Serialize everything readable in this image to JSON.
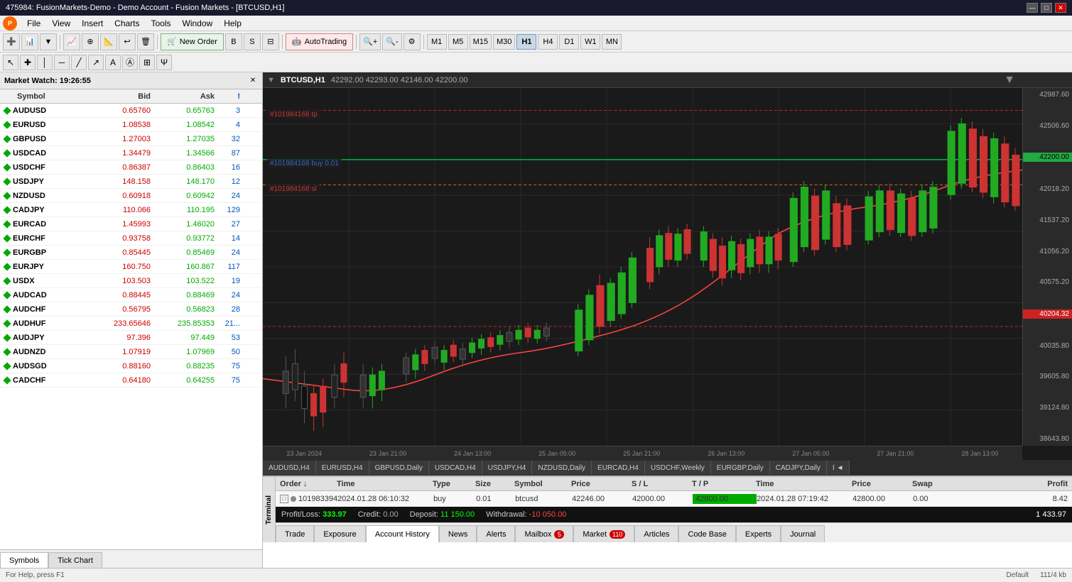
{
  "titlebar": {
    "title": "475984: FusionMarkets-Demo - Demo Account - Fusion Markets - [BTCUSD,H1]",
    "minimize": "—",
    "maximize": "□",
    "close": "✕"
  },
  "menubar": {
    "items": [
      "File",
      "View",
      "Insert",
      "Charts",
      "Tools",
      "Window",
      "Help"
    ]
  },
  "toolbar": {
    "new_order": "New Order",
    "autotrading": "AutoTrading",
    "timeframes": [
      "M1",
      "M5",
      "M15",
      "M30",
      "H1",
      "H4",
      "D1",
      "W1",
      "MN"
    ],
    "active_tf": "H1"
  },
  "market_watch": {
    "title": "Market Watch: 19:26:55",
    "columns": [
      "Symbol",
      "Bid",
      "Ask",
      "!"
    ],
    "rows": [
      {
        "symbol": "AUDUSD",
        "bid": "0.65760",
        "ask": "0.65763",
        "spread": "3",
        "dir": "up"
      },
      {
        "symbol": "EURUSD",
        "bid": "1.08538",
        "ask": "1.08542",
        "spread": "4",
        "dir": "up"
      },
      {
        "symbol": "GBPUSD",
        "bid": "1.27003",
        "ask": "1.27035",
        "spread": "32",
        "dir": "up"
      },
      {
        "symbol": "USDCAD",
        "bid": "1.34479",
        "ask": "1.34566",
        "spread": "87",
        "dir": "up"
      },
      {
        "symbol": "USDCHF",
        "bid": "0.86387",
        "ask": "0.86403",
        "spread": "16",
        "dir": "up"
      },
      {
        "symbol": "USDJPY",
        "bid": "148.158",
        "ask": "148.170",
        "spread": "12",
        "dir": "up"
      },
      {
        "symbol": "NZDUSD",
        "bid": "0.60918",
        "ask": "0.60942",
        "spread": "24",
        "dir": "up"
      },
      {
        "symbol": "CADJPY",
        "bid": "110.066",
        "ask": "110.195",
        "spread": "129",
        "dir": "up"
      },
      {
        "symbol": "EURCAD",
        "bid": "1.45993",
        "ask": "1.46020",
        "spread": "27",
        "dir": "up"
      },
      {
        "symbol": "EURCHF",
        "bid": "0.93758",
        "ask": "0.93772",
        "spread": "14",
        "dir": "up"
      },
      {
        "symbol": "EURGBP",
        "bid": "0.85445",
        "ask": "0.85469",
        "spread": "24",
        "dir": "up"
      },
      {
        "symbol": "EURJPY",
        "bid": "160.750",
        "ask": "160.867",
        "spread": "117",
        "dir": "up"
      },
      {
        "symbol": "USDX",
        "bid": "103.503",
        "ask": "103.522",
        "spread": "19",
        "dir": "up"
      },
      {
        "symbol": "AUDCAD",
        "bid": "0.88445",
        "ask": "0.88469",
        "spread": "24",
        "dir": "up"
      },
      {
        "symbol": "AUDCHF",
        "bid": "0.56795",
        "ask": "0.56823",
        "spread": "28",
        "dir": "up"
      },
      {
        "symbol": "AUDHUF",
        "bid": "233.65646",
        "ask": "235.85353",
        "spread": "21...",
        "dir": "up"
      },
      {
        "symbol": "AUDJPY",
        "bid": "97.396",
        "ask": "97.449",
        "spread": "53",
        "dir": "up"
      },
      {
        "symbol": "AUDNZD",
        "bid": "1.07919",
        "ask": "1.07969",
        "spread": "50",
        "dir": "up"
      },
      {
        "symbol": "AUDSGD",
        "bid": "0.88160",
        "ask": "0.88235",
        "spread": "75",
        "dir": "up"
      },
      {
        "symbol": "CADCHF",
        "bid": "0.64180",
        "ask": "0.64255",
        "spread": "75",
        "dir": "up"
      }
    ]
  },
  "left_tabs": {
    "tabs": [
      "Symbols",
      "Tick Chart"
    ],
    "active": "Symbols"
  },
  "chart": {
    "header": {
      "symbol": "BTCUSD,H1",
      "prices": "42292.00  42293.00  42146.00  42200.00"
    },
    "price_levels": [
      {
        "price": "42987.60",
        "y_pct": 2
      },
      {
        "price": "42506.60",
        "y_pct": 12
      },
      {
        "price": "42200.00",
        "y_pct": 20,
        "highlight": "green"
      },
      {
        "price": "42018.20",
        "y_pct": 25
      },
      {
        "price": "41537.20",
        "y_pct": 36
      },
      {
        "price": "41056.20",
        "y_pct": 47
      },
      {
        "price": "40575.20",
        "y_pct": 58
      },
      {
        "price": "40204.32",
        "y_pct": 65,
        "highlight": "red"
      },
      {
        "price": "40035.80",
        "y_pct": 67
      },
      {
        "price": "39605.80",
        "y_pct": 77
      },
      {
        "price": "39124.80",
        "y_pct": 87
      },
      {
        "price": "38643.80",
        "y_pct": 97
      }
    ],
    "order_lines": [
      {
        "label": "#101984168 tp",
        "y_pct": 8,
        "color": "#cc2222",
        "style": "dashed"
      },
      {
        "label": "#101984168 buy 0.01",
        "y_pct": 20,
        "color": "#2266cc",
        "style": "solid"
      },
      {
        "label": "#101984168 sl",
        "y_pct": 27,
        "color": "#cc2222",
        "style": "dashed"
      }
    ],
    "time_labels": [
      "23 Jan 2024",
      "23 Jan 21:00",
      "24 Jan 13:00",
      "25 Jan 05:00",
      "25 Jan 21:00",
      "26 Jan 13:00",
      "27 Jan 05:00",
      "27 Jan 21:00",
      "28 Jan 13:00"
    ]
  },
  "symbol_tabs": {
    "tabs": [
      "AUDUSD,H4",
      "EURUSD,H4",
      "GBPUSD,Daily",
      "USDCAD,H4",
      "USDJPY,H4",
      "NZDUSD,Daily",
      "EURCAD,H4",
      "USDCHF,Weekly",
      "EURGBP,Daily",
      "CADJPY,Daily",
      "I ◄"
    ]
  },
  "orders_section": {
    "columns": [
      "Order",
      "Time",
      "Type",
      "Size",
      "Symbol",
      "Price",
      "S / L",
      "T / P",
      "Time",
      "Price",
      "Swap",
      "Profit"
    ],
    "rows": [
      {
        "order": "101983394",
        "time": "2024.01.28 06:10:32",
        "type": "buy",
        "size": "0.01",
        "symbol": "btcusd",
        "price": "42246.00",
        "sl": "42000.00",
        "tp": "42800.00",
        "tp_highlight": true,
        "close_time": "2024.01.28 07:19:42",
        "close_price": "42800.00",
        "swap": "0.00",
        "profit": "8.42"
      }
    ],
    "profit_bar": {
      "label_pnl": "Profit/Loss: 333.97",
      "label_credit": "Credit: 0.00",
      "label_deposit": "Deposit: 11 150.00",
      "label_withdrawal": "Withdrawal: -10 050.00",
      "total": "1 433.97"
    }
  },
  "bottom_tabs": {
    "tabs": [
      "Trade",
      "Exposure",
      "Account History",
      "News",
      "Alerts",
      "Mailbox",
      "Market",
      "Articles",
      "Code Base",
      "Experts",
      "Journal"
    ],
    "mailbox_badge": "5",
    "market_badge": "110",
    "active": "Account History"
  },
  "statusbar": {
    "left": "For Help, press F1",
    "zoom": "111/4 kb",
    "mode": "Default"
  }
}
